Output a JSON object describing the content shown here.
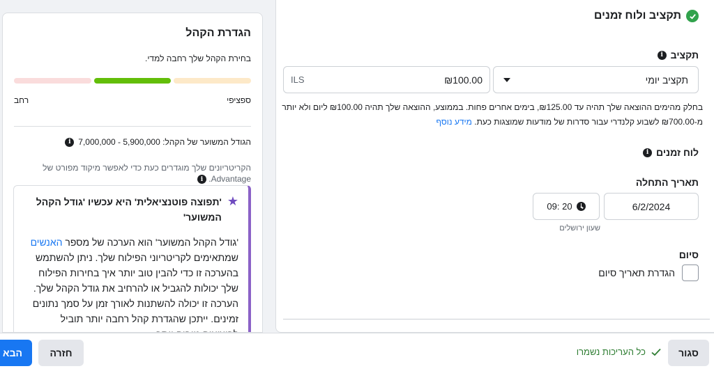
{
  "budget_schedule": {
    "title": "תקציב ולוח זמנים",
    "budget_label": "תקציב",
    "budget_type": "תקציב יומי",
    "budget_amount": "₪100.00",
    "currency": "ILS",
    "description": "בחלק מהימים ההוצאה שלך תהיה עד ₪125.00, בימים אחרים פחות. בממוצע, ההוצאה שלך תהיה ₪100.00 ליום ולא יותר מ-₪700.00 לשבוע קלנדרי עבור סדרות של מודעות שמוצגות כעת.",
    "more_info": "מידע נוסף",
    "schedule_label": "לוח זמנים",
    "start_date_label": "תאריך התחלה",
    "start_date": "6/2/2024",
    "start_time": "20 :09",
    "timezone": "שעון ירושלים",
    "end_label": "סיום",
    "end_checkbox_label": "הגדרת תאריך סיום"
  },
  "audience": {
    "title": "הגדרת הקהל",
    "subtitle": "בחירת הקהל שלך רחבה למדי.",
    "meter_label_specific": "ספציפי",
    "meter_label_broad": "רחב",
    "meter_colors": [
      "#fde9c8",
      "#63be09",
      "#fadcdc"
    ],
    "estimated_size": "הגודל המשוער של הקהל: 5,900,000 - 7,000,000",
    "criteria": "הקריטריונים שלך מוגדרים כעת כדי לאפשר מיקוד מפורט של Advantage.",
    "notice_title": "'תפוצה פוטנציאלית' היא עכשיו 'גודל הקהל המשוער'",
    "notice_body_1": "'גודל הקהל המשוער' הוא הערכה של מספר ",
    "notice_link": "האנשים",
    "notice_body_2": " שמתאימים לקריטריוני הפילוח שלך. ניתן להשתמש בהערכה זו כדי להבין טוב יותר איך בחירות הפילוח שלך יכולות להגביל או להרחיב את גודל הקהל שלך. הערכה זו יכולה להשתנות לאורך זמן על סמך נתונים זמינים. ייתכן שהגדרת קהל רחבה יותר תוביל לביצועים טובים יותר."
  },
  "footer": {
    "close": "סגור",
    "saved": "כל העריכות נשמרו",
    "back": "חזרה",
    "next": "הבא"
  }
}
